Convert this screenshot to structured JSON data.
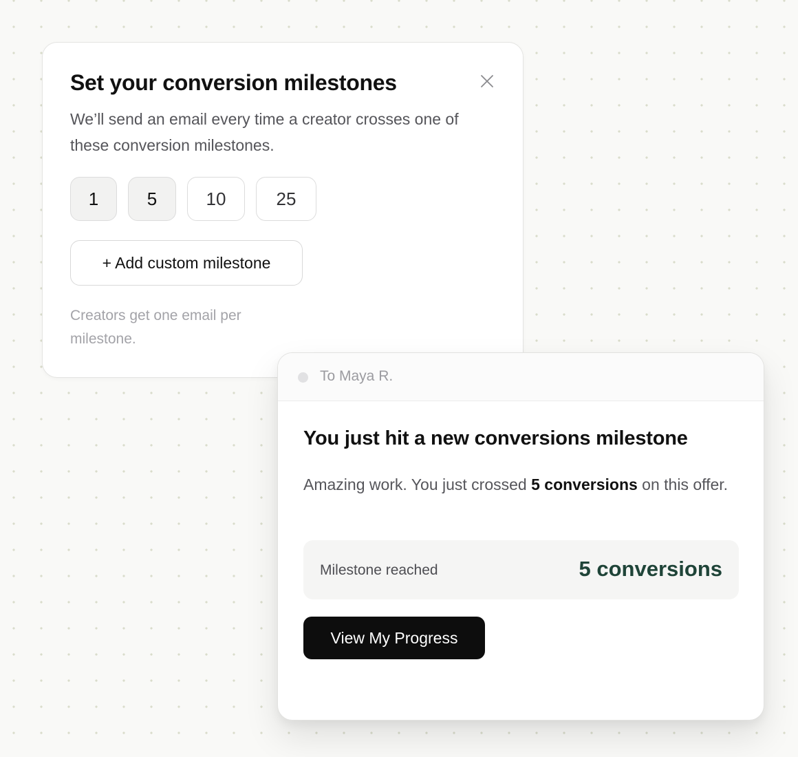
{
  "settings": {
    "title": "Set your conversion milestones",
    "description": "We’ll send an email every time a creator crosses one of these conversion milestones.",
    "milestones": [
      {
        "label": "1",
        "selected": true
      },
      {
        "label": "5",
        "selected": true
      },
      {
        "label": "10",
        "selected": false
      },
      {
        "label": "25",
        "selected": false
      }
    ],
    "add_button_label": "+ Add custom milestone",
    "footnote": "Creators get one email per milestone."
  },
  "email": {
    "recipient": "To Maya R.",
    "title": "You just hit a new conversions milestone",
    "body_prefix": "Amazing work. You just crossed ",
    "body_highlight": "5 conversions",
    "body_suffix": " on this offer.",
    "milestone_label": "Milestone reached",
    "milestone_value": "5 conversions",
    "cta_label": "View My Progress"
  },
  "colors": {
    "accent_green": "#1f4438",
    "cta_background": "#0d0d0d",
    "page_background": "#f9f9f7"
  },
  "icons": {
    "close": "close-icon"
  }
}
